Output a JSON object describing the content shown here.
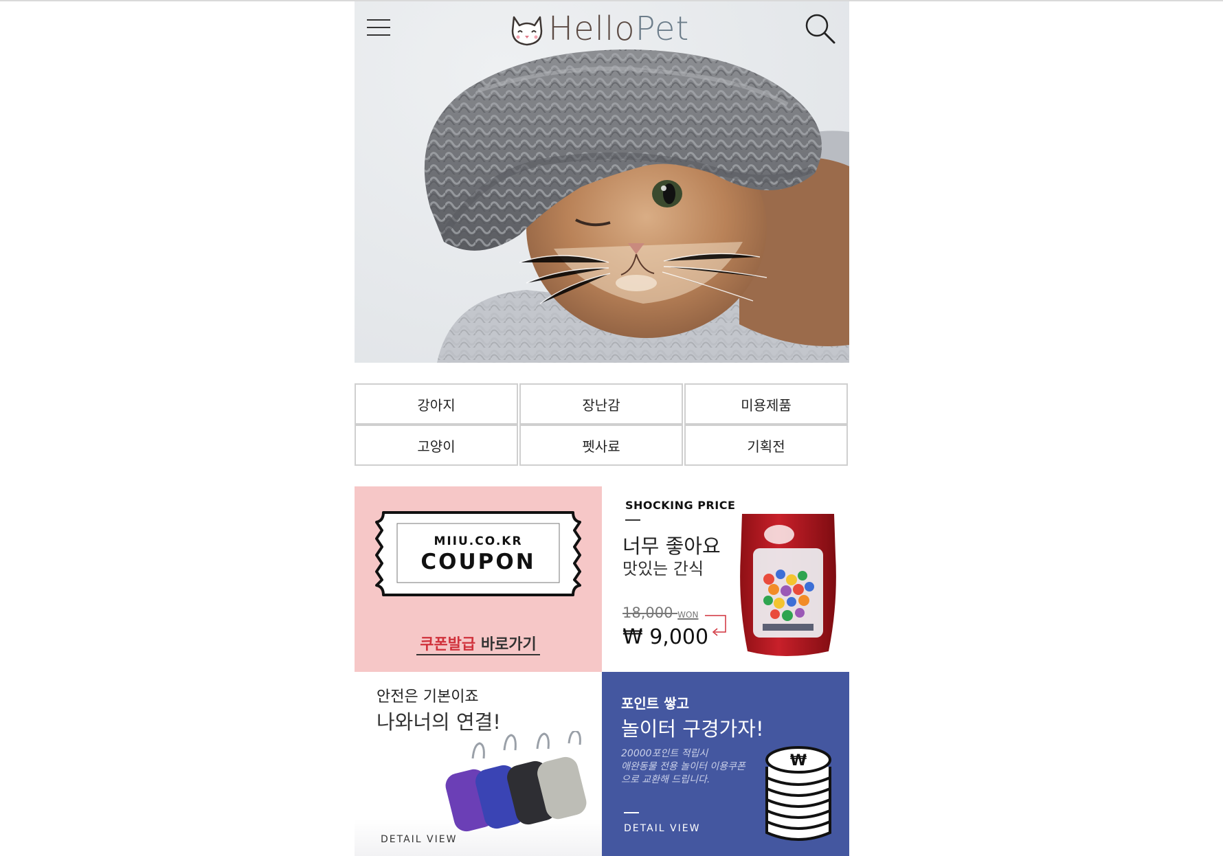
{
  "header": {
    "logo_text_a": "Hello",
    "logo_text_b": "Pet",
    "menu_icon": "hamburger-icon",
    "search_icon": "search-icon"
  },
  "hero": {
    "image": "cat-in-knit-hat"
  },
  "categories": [
    {
      "label": "강아지"
    },
    {
      "label": "장난감"
    },
    {
      "label": "미용제품"
    },
    {
      "label": "고양이"
    },
    {
      "label": "펫사료"
    },
    {
      "label": "기획전"
    }
  ],
  "banners": {
    "coupon": {
      "small": "MIIU.CO.KR",
      "big": "COUPON",
      "link_red": "쿠폰발급",
      "link_dark": " 바로가기",
      "bg": "#f6c7c7"
    },
    "shocking": {
      "title": "SHOCKING PRICE",
      "headline": "너무 좋아요",
      "sub": "맛있는 간식",
      "old_price": "18,000",
      "old_unit": "WON",
      "new_price": "₩ 9,000"
    },
    "safety": {
      "line1": "안전은 기본이죠",
      "line2": "나와너의 연결!",
      "detail": "DETAIL VIEW"
    },
    "points": {
      "line1": "포인트 쌓고",
      "line2": "놀이터 구경가자!",
      "desc1": "20000포인트 적립시",
      "desc2": "애완동물 전용 놀이터 이용쿠폰",
      "desc3": "으로 교환해 드립니다.",
      "detail": "DETAIL VIEW",
      "bg": "#4457a0"
    }
  }
}
